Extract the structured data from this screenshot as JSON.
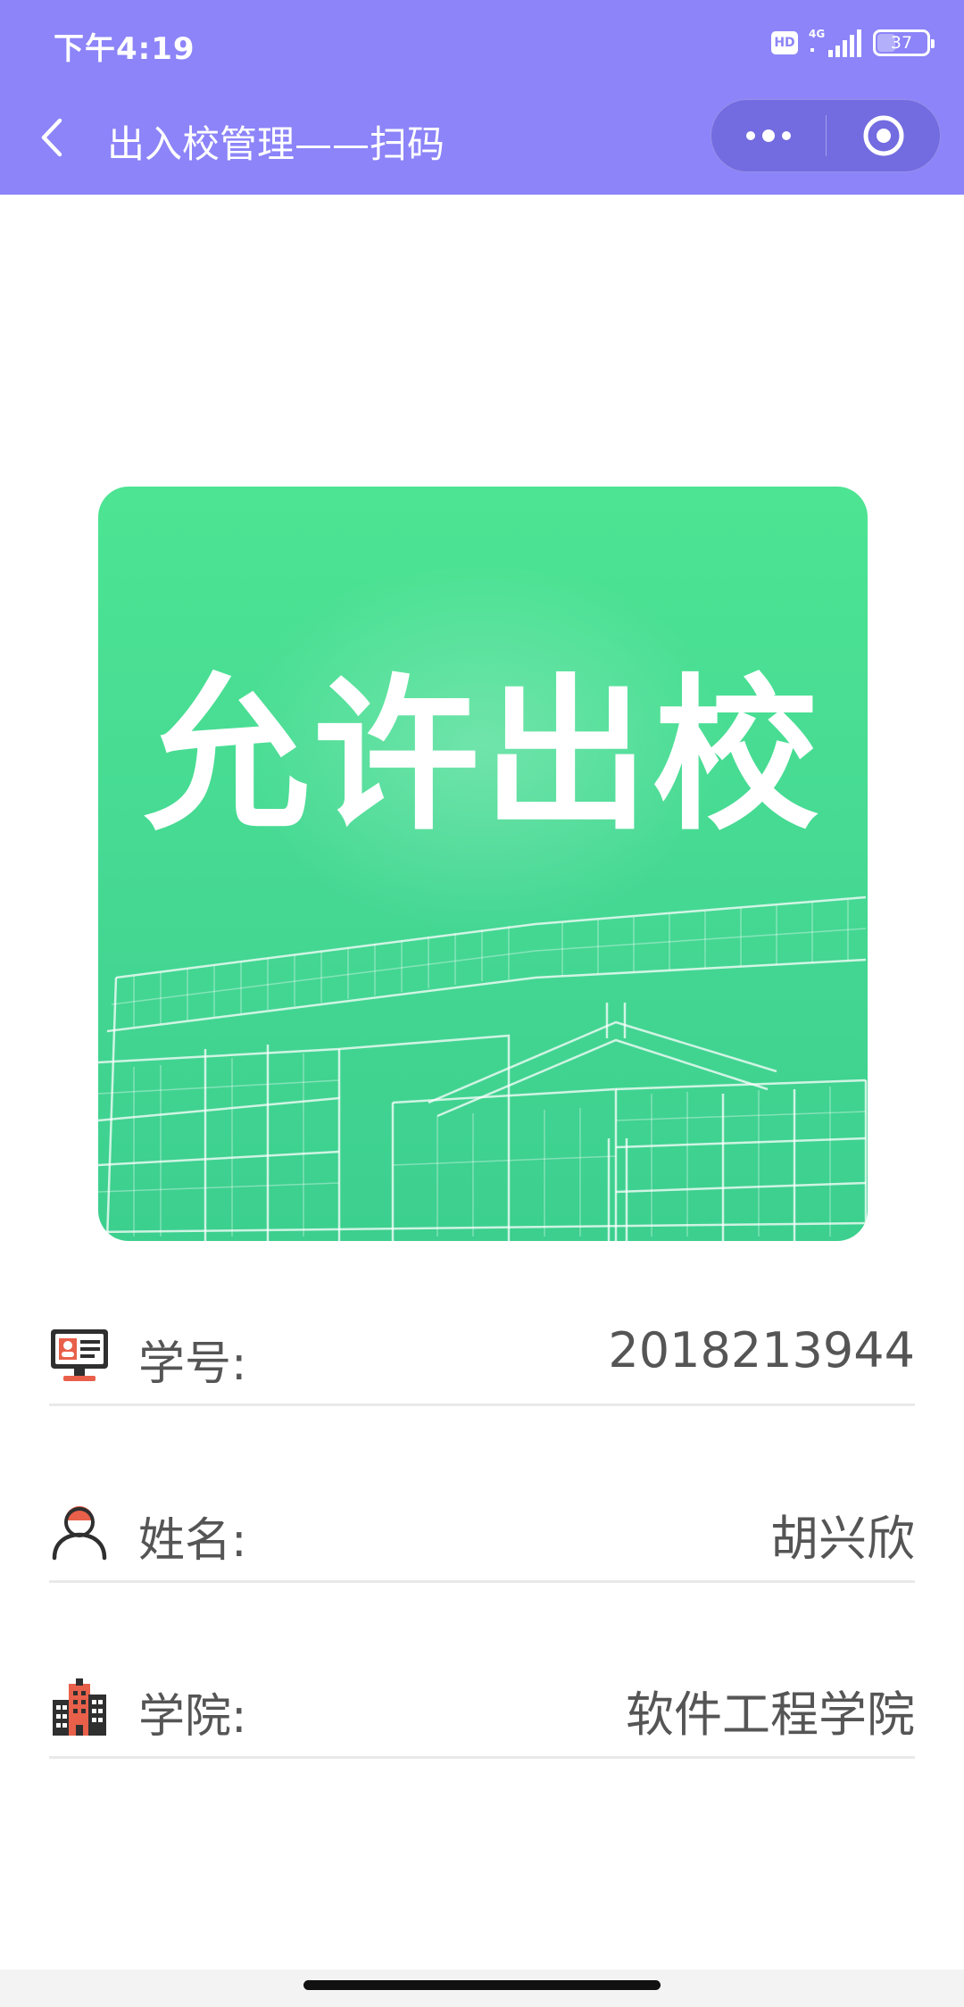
{
  "status_bar": {
    "time": "下午4:19",
    "hd": "HD",
    "network": "4G",
    "battery": "37"
  },
  "nav": {
    "title": "出入校管理——扫码"
  },
  "pass": {
    "text": "允许出校"
  },
  "info": {
    "student_id": {
      "label": "学号:",
      "value": "2018213944",
      "icon": "id-card-icon"
    },
    "name": {
      "label": "姓名:",
      "value": "胡兴欣",
      "icon": "person-icon"
    },
    "college": {
      "label": "学院:",
      "value": "软件工程学院",
      "icon": "building-icon"
    }
  }
}
